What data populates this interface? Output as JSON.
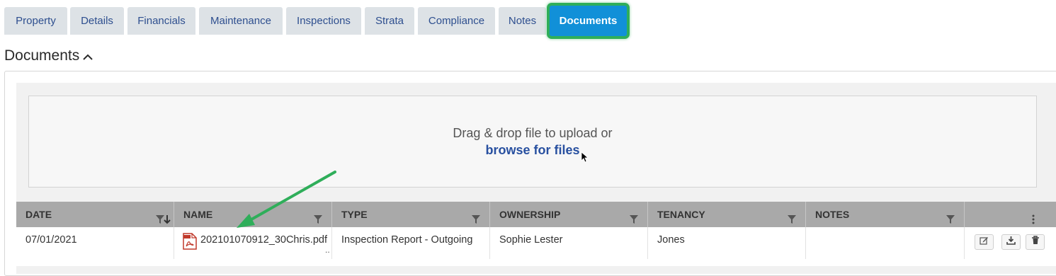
{
  "tabs": [
    {
      "label": "Property",
      "name": "tab-property"
    },
    {
      "label": "Details",
      "name": "tab-details"
    },
    {
      "label": "Financials",
      "name": "tab-financials"
    },
    {
      "label": "Maintenance",
      "name": "tab-maintenance"
    },
    {
      "label": "Inspections",
      "name": "tab-inspections"
    },
    {
      "label": "Strata",
      "name": "tab-strata"
    },
    {
      "label": "Compliance",
      "name": "tab-compliance"
    },
    {
      "label": "Notes",
      "name": "tab-notes"
    },
    {
      "label": "Documents",
      "name": "tab-documents",
      "active": true
    }
  ],
  "section": {
    "title": "Documents"
  },
  "upload": {
    "prompt": "Drag & drop file to upload or",
    "browse_label": "browse for files"
  },
  "table": {
    "columns": [
      "DATE",
      "NAME",
      "TYPE",
      "OWNERSHIP",
      "TENANCY",
      "NOTES"
    ],
    "rows": [
      {
        "date": "07/01/2021",
        "name": "202101070912_30Chris.pdf",
        "type": "Inspection Report - Outgoing",
        "ownership": "Sophie Lester",
        "tenancy": "Jones",
        "notes": ""
      }
    ],
    "truncation_mark": ".."
  },
  "colors": {
    "tab_bg": "#dde2e6",
    "tab_text": "#2e4f8f",
    "active_tab": "#1190d8",
    "highlight": "#2fae5a",
    "link": "#2850a0",
    "header_bg": "#a9a9a9"
  },
  "icons": {
    "sort": "sort-down-icon",
    "filter": "filter-icon",
    "menu": "kebab-menu-icon",
    "file": "pdf-file-icon",
    "edit": "edit-icon",
    "download": "download-icon",
    "delete": "trash-icon"
  }
}
